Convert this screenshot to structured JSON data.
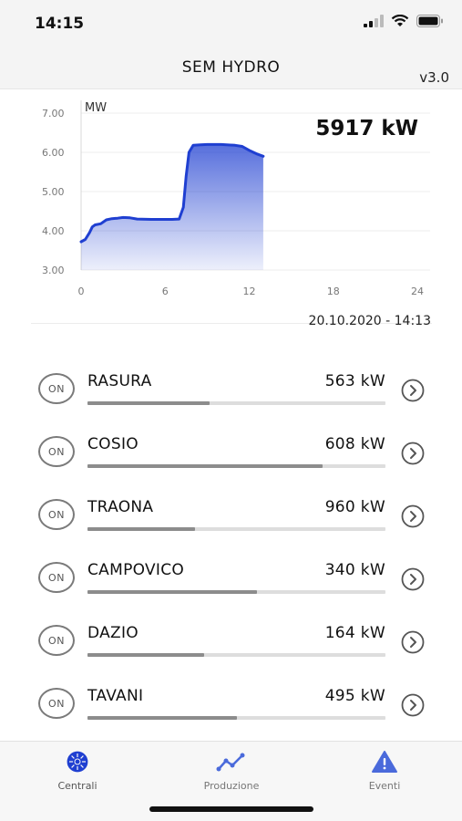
{
  "status": {
    "time": "14:15"
  },
  "header": {
    "title": "SEM HYDRO",
    "version": "v3.0"
  },
  "summary": {
    "total_power": "5917 kW",
    "timestamp": "20.10.2020 - 14:13"
  },
  "chart_data": {
    "type": "area",
    "ylabel": "MW",
    "ylim": [
      3.0,
      7.0
    ],
    "xlim": [
      0,
      24
    ],
    "xticks": [
      "0",
      "6",
      "12",
      "18",
      "24"
    ],
    "yticks": [
      "7.00",
      "6.00",
      "5.00",
      "4.00",
      "3.00"
    ],
    "grid": true,
    "color": "#1f3fd1",
    "x": [
      0,
      0.3,
      0.6,
      0.8,
      1.0,
      1.4,
      1.8,
      2.2,
      2.6,
      3.0,
      3.5,
      4.0,
      5.0,
      6.0,
      6.5,
      7.0,
      7.3,
      7.5,
      7.7,
      8.0,
      8.5,
      9.0,
      10.0,
      11.0,
      11.5,
      12.0,
      12.3,
      12.6,
      13.0
    ],
    "y": [
      3.72,
      3.78,
      3.95,
      4.1,
      4.15,
      4.18,
      4.28,
      4.31,
      4.32,
      4.34,
      4.33,
      4.3,
      4.29,
      4.29,
      4.29,
      4.3,
      4.6,
      5.4,
      6.0,
      6.18,
      6.19,
      6.2,
      6.2,
      6.18,
      6.15,
      6.05,
      6.0,
      5.95,
      5.9
    ]
  },
  "plants": [
    {
      "status": "ON",
      "name": "RASURA",
      "power": "563 kW",
      "level": 0.41
    },
    {
      "status": "ON",
      "name": "COSIO",
      "power": "608 kW",
      "level": 0.79
    },
    {
      "status": "ON",
      "name": "TRAONA",
      "power": "960 kW",
      "level": 0.36
    },
    {
      "status": "ON",
      "name": "CAMPOVICO",
      "power": "340 kW",
      "level": 0.57
    },
    {
      "status": "ON",
      "name": "DAZIO",
      "power": "164 kW",
      "level": 0.39
    },
    {
      "status": "ON",
      "name": "TAVANI",
      "power": "495 kW",
      "level": 0.5
    }
  ],
  "tabs": [
    {
      "label": "Centrali",
      "icon": "plant-icon",
      "active": true
    },
    {
      "label": "Produzione",
      "icon": "trend-icon",
      "active": false
    },
    {
      "label": "Eventi",
      "icon": "warning-icon",
      "active": false
    }
  ],
  "colors": {
    "accent": "#1f3fd1",
    "bar_fill": "#8c8c8c",
    "bar_track": "#dddddd"
  }
}
